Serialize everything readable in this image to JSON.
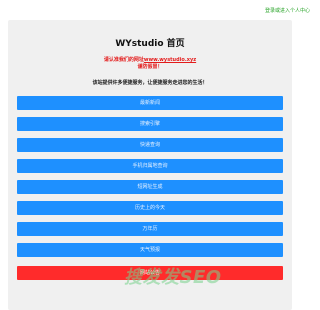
{
  "topbar": {
    "login_link": "登录或进入个人中心"
  },
  "main": {
    "title": "WYstudio 首页",
    "notice_prefix": "请认准我们的网址",
    "notice_url": "www.wystudio.xyz",
    "notice_warning": "谨防假冒！",
    "intro": "该站提供许多便捷服务，让便捷服务走进您的生活！"
  },
  "services": [
    {
      "label": "最新新闻",
      "color": "#1e90ff"
    },
    {
      "label": "搜索引擎",
      "color": "#1e90ff"
    },
    {
      "label": "快递查询",
      "color": "#1e90ff"
    },
    {
      "label": "手机归属地查询",
      "color": "#1e90ff"
    },
    {
      "label": "短网址生成",
      "color": "#1e90ff"
    },
    {
      "label": "历史上的今天",
      "color": "#1e90ff"
    },
    {
      "label": "万年历",
      "color": "#1e90ff"
    },
    {
      "label": "天气预报",
      "color": "#1e90ff"
    },
    {
      "label": "网站公告",
      "color": "#ff2b2b"
    }
  ],
  "watermark": {
    "text": "搜发发SEO"
  }
}
